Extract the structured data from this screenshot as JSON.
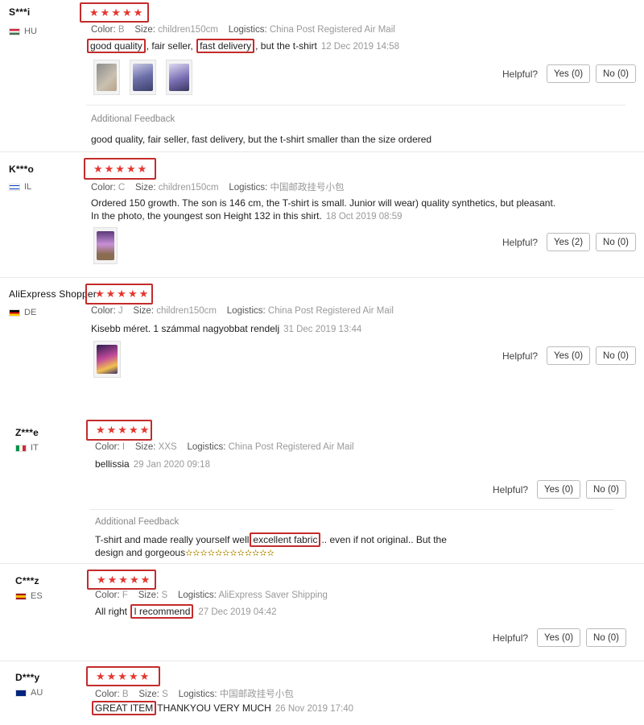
{
  "labels": {
    "color": "Color:",
    "size": "Size:",
    "logistics": "Logistics:",
    "helpful": "Helpful?",
    "additional": "Additional Feedback"
  },
  "stars": "★★★★★",
  "mini_stars": "✫✫✫✫✫✫✫✫✫✫✫✫",
  "reviews": [
    {
      "name": "S***i",
      "country": "HU",
      "flag_colors": [
        "#cd2a3e",
        "#ffffff",
        "#436f4d"
      ],
      "color": "B",
      "size": "children150cm",
      "logistics": "China Post Registered Air Mail",
      "text": {
        "hl1": "good quality",
        "p1": ", fair seller, ",
        "hl2": "fast delivery",
        "p2": ", but the t-shirt"
      },
      "date": "12 Dec 2019 14:58",
      "yes": "Yes (0)",
      "no": "No (0)",
      "additional_text": "good quality, fair seller, fast delivery, but the t-shirt smaller than the size ordered"
    },
    {
      "name": "K***o",
      "country": "IL",
      "flag_colors": [
        "#ffffff",
        "#0038b8",
        "#ffffff"
      ],
      "color": "C",
      "size": "children150cm",
      "logistics": "中国邮政挂号小包",
      "text": "Ordered 150 growth. The son is 146 cm, the T-shirt is small. Junior will wear) quality synthetics, but pleasant. In the photo, the youngest son Height 132 in this shirt.",
      "date": "18 Oct 2019 08:59",
      "yes": "Yes (2)",
      "no": "No (0)"
    },
    {
      "name": "AliExpress Shopper",
      "country": "DE",
      "flag_colors": [
        "#000000",
        "#dd0000",
        "#ffce00"
      ],
      "color": "J",
      "size": "children150cm",
      "logistics": "China Post Registered Air Mail",
      "text": "Kisebb méret. 1 számmal nagyobbat rendelj",
      "date": "31 Dec 2019 13:44",
      "yes": "Yes (0)",
      "no": "No (0)"
    },
    {
      "name": "Z***e",
      "country": "IT",
      "flag_colors": [
        "#009246",
        "#ffffff",
        "#ce2b37"
      ],
      "color": "I",
      "size": "XXS",
      "logistics": "China Post Registered Air Mail",
      "text": "bellissia",
      "date": "29 Jan 2020 09:18",
      "yes": "Yes (0)",
      "no": "No (0)",
      "additional": {
        "p1": "T-shirt and made really yourself well",
        "hl": "excellent fabric",
        "p2": ".. even if not original.. But the design and gorgeous"
      }
    },
    {
      "name": "C***z",
      "country": "ES",
      "flag_colors": [
        "#aa151b",
        "#f1bf00",
        "#aa151b"
      ],
      "color": "F",
      "size": "S",
      "logistics": "AliExpress Saver Shipping",
      "text": {
        "p1": "All right",
        "hl": "I recommend"
      },
      "date": "27 Dec 2019 04:42",
      "yes": "Yes (0)",
      "no": "No (0)"
    },
    {
      "name": "D***y",
      "country": "AU",
      "flag_colors": [
        "#00247d",
        "#00247d",
        "#00247d"
      ],
      "color": "B",
      "size": "S",
      "logistics": "中国邮政挂号小包",
      "text": {
        "hl": "GREAT ITEM",
        "p1": "THANKYOU VERY MUCH"
      },
      "date": "26 Nov 2019 17:40"
    }
  ]
}
